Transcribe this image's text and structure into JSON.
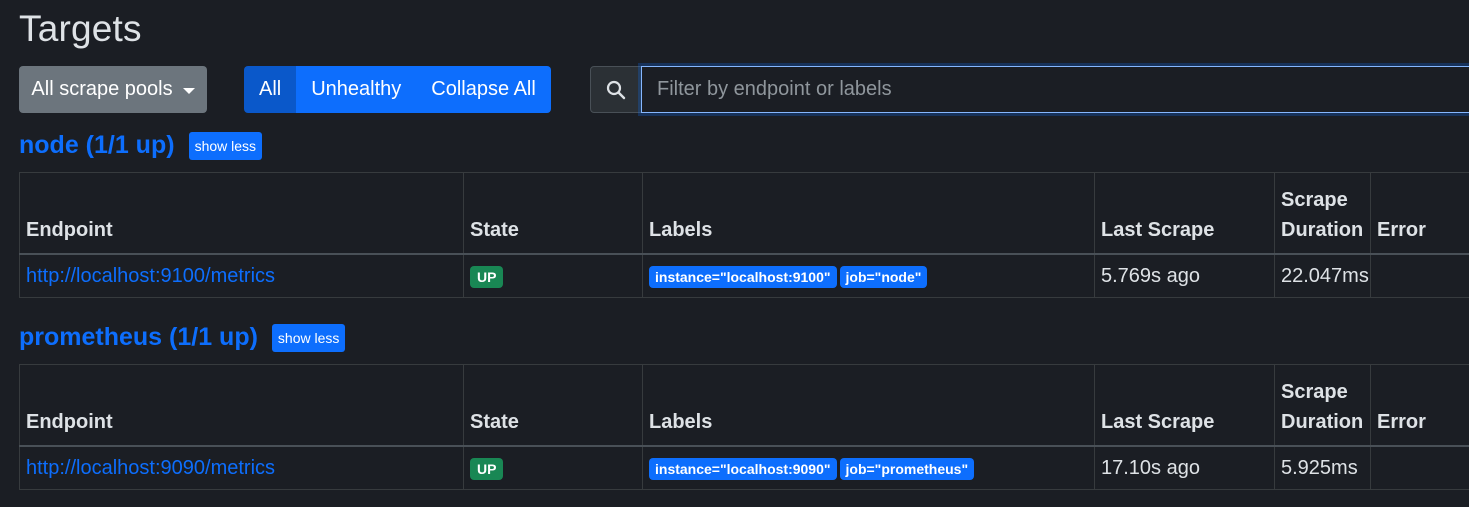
{
  "page": {
    "title": "Targets"
  },
  "toolbar": {
    "pool_select": "All scrape pools",
    "filter_buttons": [
      "All",
      "Unhealthy",
      "Collapse All"
    ],
    "search_placeholder": "Filter by endpoint or labels"
  },
  "columns": {
    "endpoint": "Endpoint",
    "state": "State",
    "labels": "Labels",
    "last_scrape": "Last Scrape",
    "scrape_duration_1": "Scrape",
    "scrape_duration_2": "Duration",
    "error": "Error"
  },
  "pools": [
    {
      "title": "node (1/1 up)",
      "toggle": "show less",
      "target": {
        "endpoint": "http://localhost:9100/metrics",
        "state": "UP",
        "labels": [
          "instance=\"localhost:9100\"",
          "job=\"node\""
        ],
        "last_scrape": "5.769s ago",
        "duration": "22.047ms",
        "error": ""
      }
    },
    {
      "title": "prometheus (1/1 up)",
      "toggle": "show less",
      "target": {
        "endpoint": "http://localhost:9090/metrics",
        "state": "UP",
        "labels": [
          "instance=\"localhost:9090\"",
          "job=\"prometheus\""
        ],
        "last_scrape": "17.10s ago",
        "duration": "5.925ms",
        "error": ""
      }
    }
  ],
  "colors": {
    "accent": "#0d6efd",
    "up": "#198754",
    "background": "#1b1e24"
  }
}
